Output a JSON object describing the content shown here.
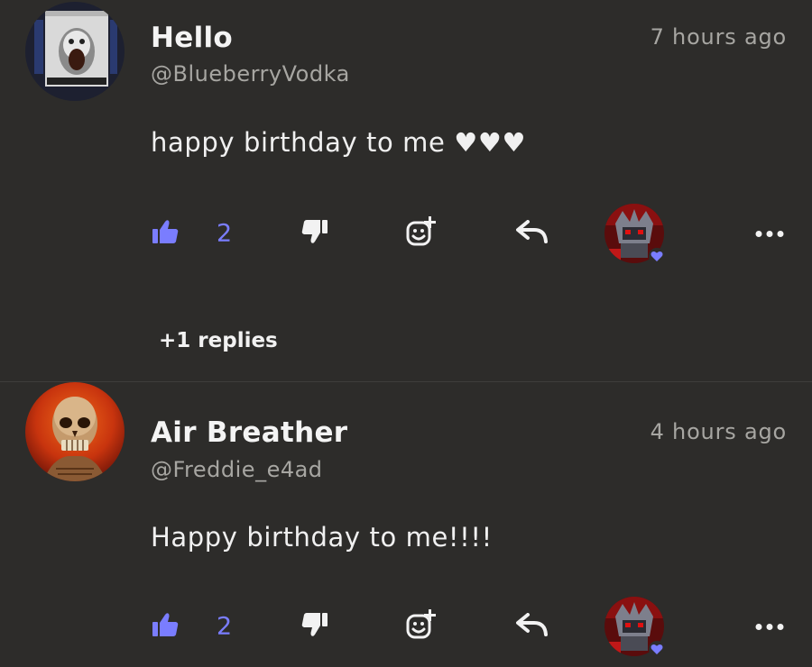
{
  "comments": [
    {
      "author": "Hello",
      "handle": "@BlueberryVodka",
      "time": "7 hours ago",
      "text": "happy birthday to me ♥♥♥",
      "likes": "2",
      "replies_label": "+1 replies"
    },
    {
      "author": "Air Breather",
      "handle": "@Freddie_e4ad",
      "time": "4 hours ago",
      "text": "Happy birthday to me!!!!",
      "likes": "2"
    }
  ],
  "colors": {
    "background": "#2d2c2a",
    "accent": "#7a7dff",
    "muted_text": "#a7a6a2"
  },
  "icons": {
    "like": "thumbs-up-icon",
    "dislike": "thumbs-down-icon",
    "react": "add-reaction-icon",
    "reply": "reply-arrow-icon",
    "more": "more-dots-icon",
    "heart": "heart-icon"
  }
}
